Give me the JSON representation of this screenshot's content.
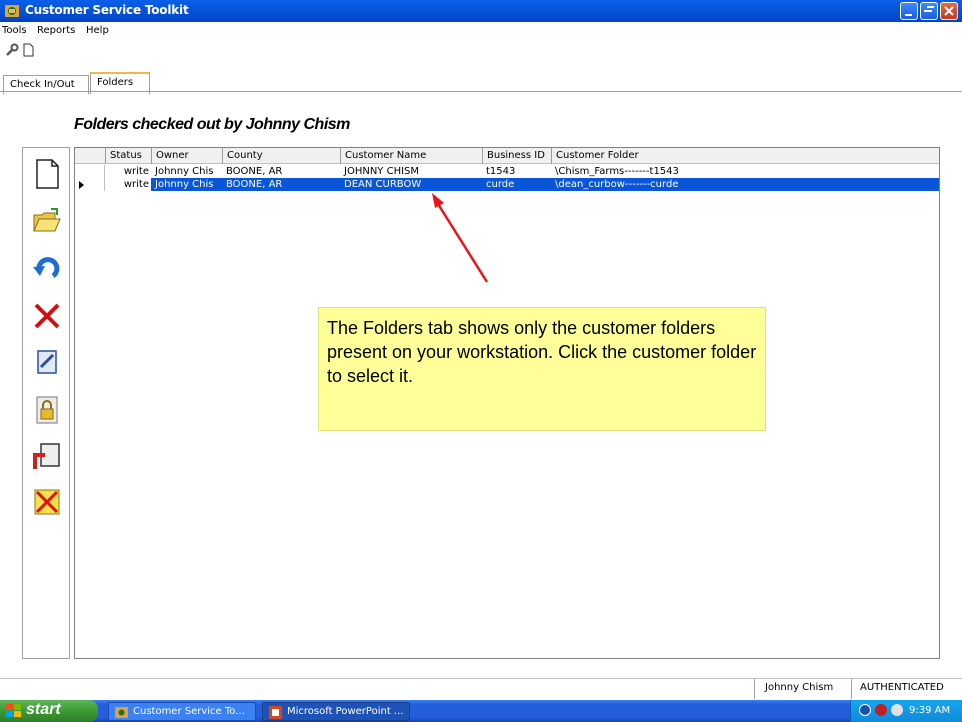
{
  "window": {
    "title": "Customer Service Toolkit"
  },
  "menu": {
    "items": [
      "Tools",
      "Reports",
      "Help"
    ]
  },
  "tabs": [
    {
      "label": "Check In/Out"
    },
    {
      "label": "Folders"
    }
  ],
  "heading": "Folders checked out by Johnny Chism",
  "grid": {
    "columns": [
      "Status",
      "Owner",
      "County",
      "Customer Name",
      "Business ID",
      "Customer Folder"
    ],
    "rows": [
      {
        "status": "write",
        "owner": "Johnny Chis",
        "county": "BOONE, AR",
        "customer_name": "JOHNNY CHISM",
        "business_id": "t1543",
        "customer_folder": "\\Chism_Farms-------t1543",
        "selected": false
      },
      {
        "status": "write",
        "owner": "Johnny Chis",
        "county": "BOONE, AR",
        "customer_name": "DEAN CURBOW",
        "business_id": "curde",
        "customer_folder": "\\dean_curbow-------curde",
        "selected": true
      }
    ]
  },
  "side_toolbar": [
    "new-document-icon",
    "open-folder-icon",
    "refresh-icon",
    "delete-icon",
    "edit-icon",
    "lock-icon",
    "export-icon",
    "cancel-icon"
  ],
  "callout": {
    "text": "The Folders tab shows only the customer folders present on your workstation. Click the customer folder to select it."
  },
  "statusbar": {
    "user": "Johnny Chism",
    "auth": "AUTHENTICATED"
  },
  "taskbar": {
    "start_label": "start",
    "tasks": [
      "Customer Service To...",
      "Microsoft PowerPoint ..."
    ],
    "clock": "9:39 AM"
  },
  "colors": {
    "title_bar": "#0756d9",
    "selection": "#0a56d8",
    "callout_bg": "#ffff99",
    "arrow": "#e8161b"
  }
}
